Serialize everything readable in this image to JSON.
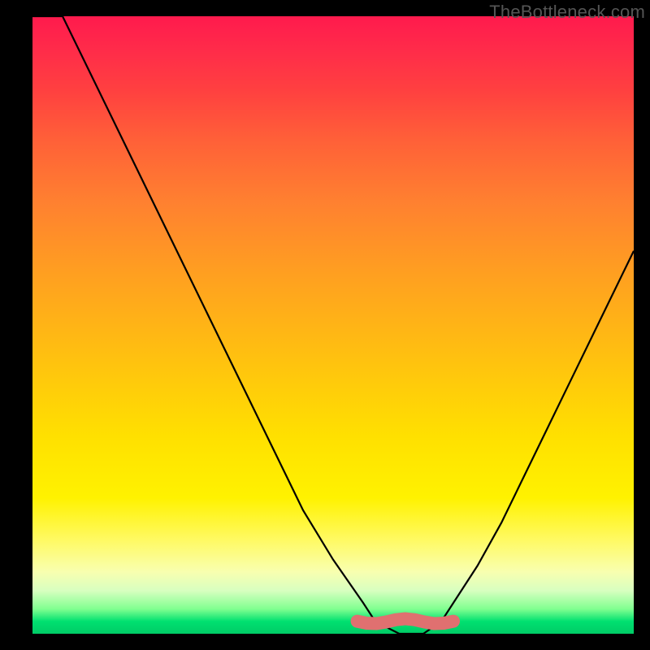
{
  "watermark": "TheBottleneck.com",
  "colors": {
    "frame": "#000000",
    "curve": "#000000",
    "optimal_zone": "#e07070"
  },
  "chart_data": {
    "type": "line",
    "title": "",
    "xlabel": "",
    "ylabel": "",
    "xlim": [
      0,
      100
    ],
    "ylim": [
      0,
      100
    ],
    "grid": false,
    "legend": false,
    "series": [
      {
        "name": "bottleneck-curve",
        "x": [
          0,
          5,
          10,
          15,
          20,
          25,
          30,
          35,
          40,
          45,
          50,
          55,
          57,
          61,
          65,
          68,
          70,
          74,
          78,
          82,
          86,
          90,
          94,
          98,
          100
        ],
        "y": [
          110,
          100,
          90,
          80,
          70,
          60,
          50,
          40,
          30,
          20,
          12,
          5,
          2,
          0,
          0,
          2,
          5,
          11,
          18,
          26,
          34,
          42,
          50,
          58,
          62
        ],
        "note": "V-shaped bottleneck curve: high bottleneck on the left descending steeply to a flat optimal zone near x≈57–68, then rising again on the right. y is bottleneck percentage (0 = no bottleneck / green, 100 = full bottleneck / red)."
      }
    ],
    "optimal_zone": {
      "name": "optimal-range-marker",
      "x_start": 54,
      "x_end": 70,
      "y": 1.5,
      "note": "Thick salmon horizontal band marking the sweet-spot region at the bottom of the V."
    }
  }
}
